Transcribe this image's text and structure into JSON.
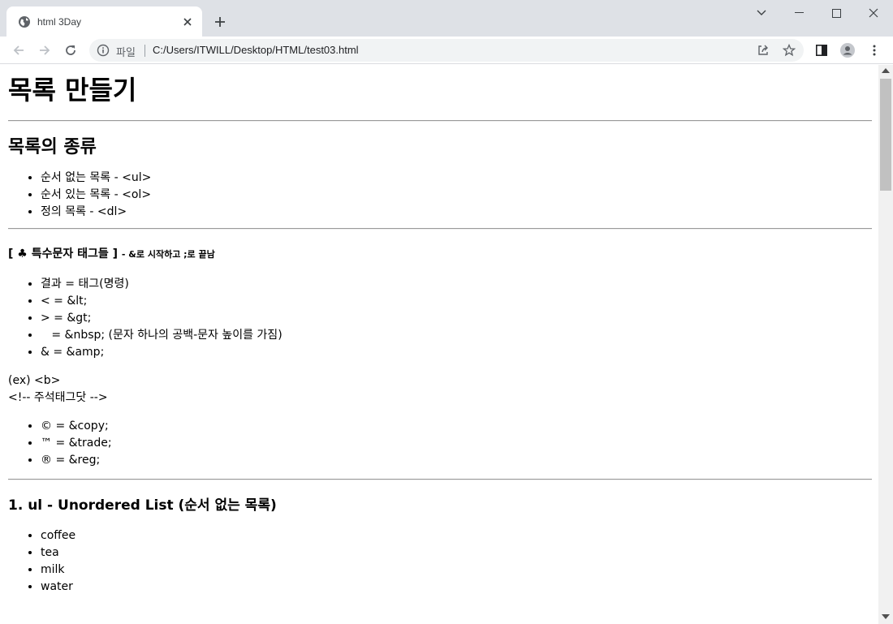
{
  "browser": {
    "tab_title": "html 3Day",
    "omnibox_scheme": "파일",
    "url": "C:/Users/ITWILL/Desktop/HTML/test03.html"
  },
  "page": {
    "title": "목록 만들기",
    "section_kinds": {
      "heading": "목록의 종류",
      "items": [
        "순서 없는 목록 - <ul>",
        "순서 있는 목록 - <ol>",
        "정의 목록 - <dl>"
      ]
    },
    "special": {
      "heading": "[ ♣ 특수문자 태그들 ]",
      "subheading": "- &로 시작하고 ;로 끝남",
      "items": [
        "결과 = 태그(명령)",
        "< = &lt;",
        "> = &gt;",
        "   = &nbsp; (문자 하나의 공백-문자 높이를 가짐)",
        "& = &amp;"
      ],
      "example_line": "(ex) <b>",
      "comment_line": "<!-- 주석태그닷 -->",
      "items2": [
        "© = &copy;",
        "™ = &trade;",
        "® = &reg;"
      ]
    },
    "ul_section": {
      "heading": "1. ul - Unordered List (순서 없는 목록)",
      "items": [
        "coffee",
        "tea",
        "milk",
        "water"
      ]
    }
  },
  "colors": {
    "titlebar_bg": "#dee1e6",
    "omnibox_bg": "#f1f3f4",
    "icon": "#5f6368"
  }
}
